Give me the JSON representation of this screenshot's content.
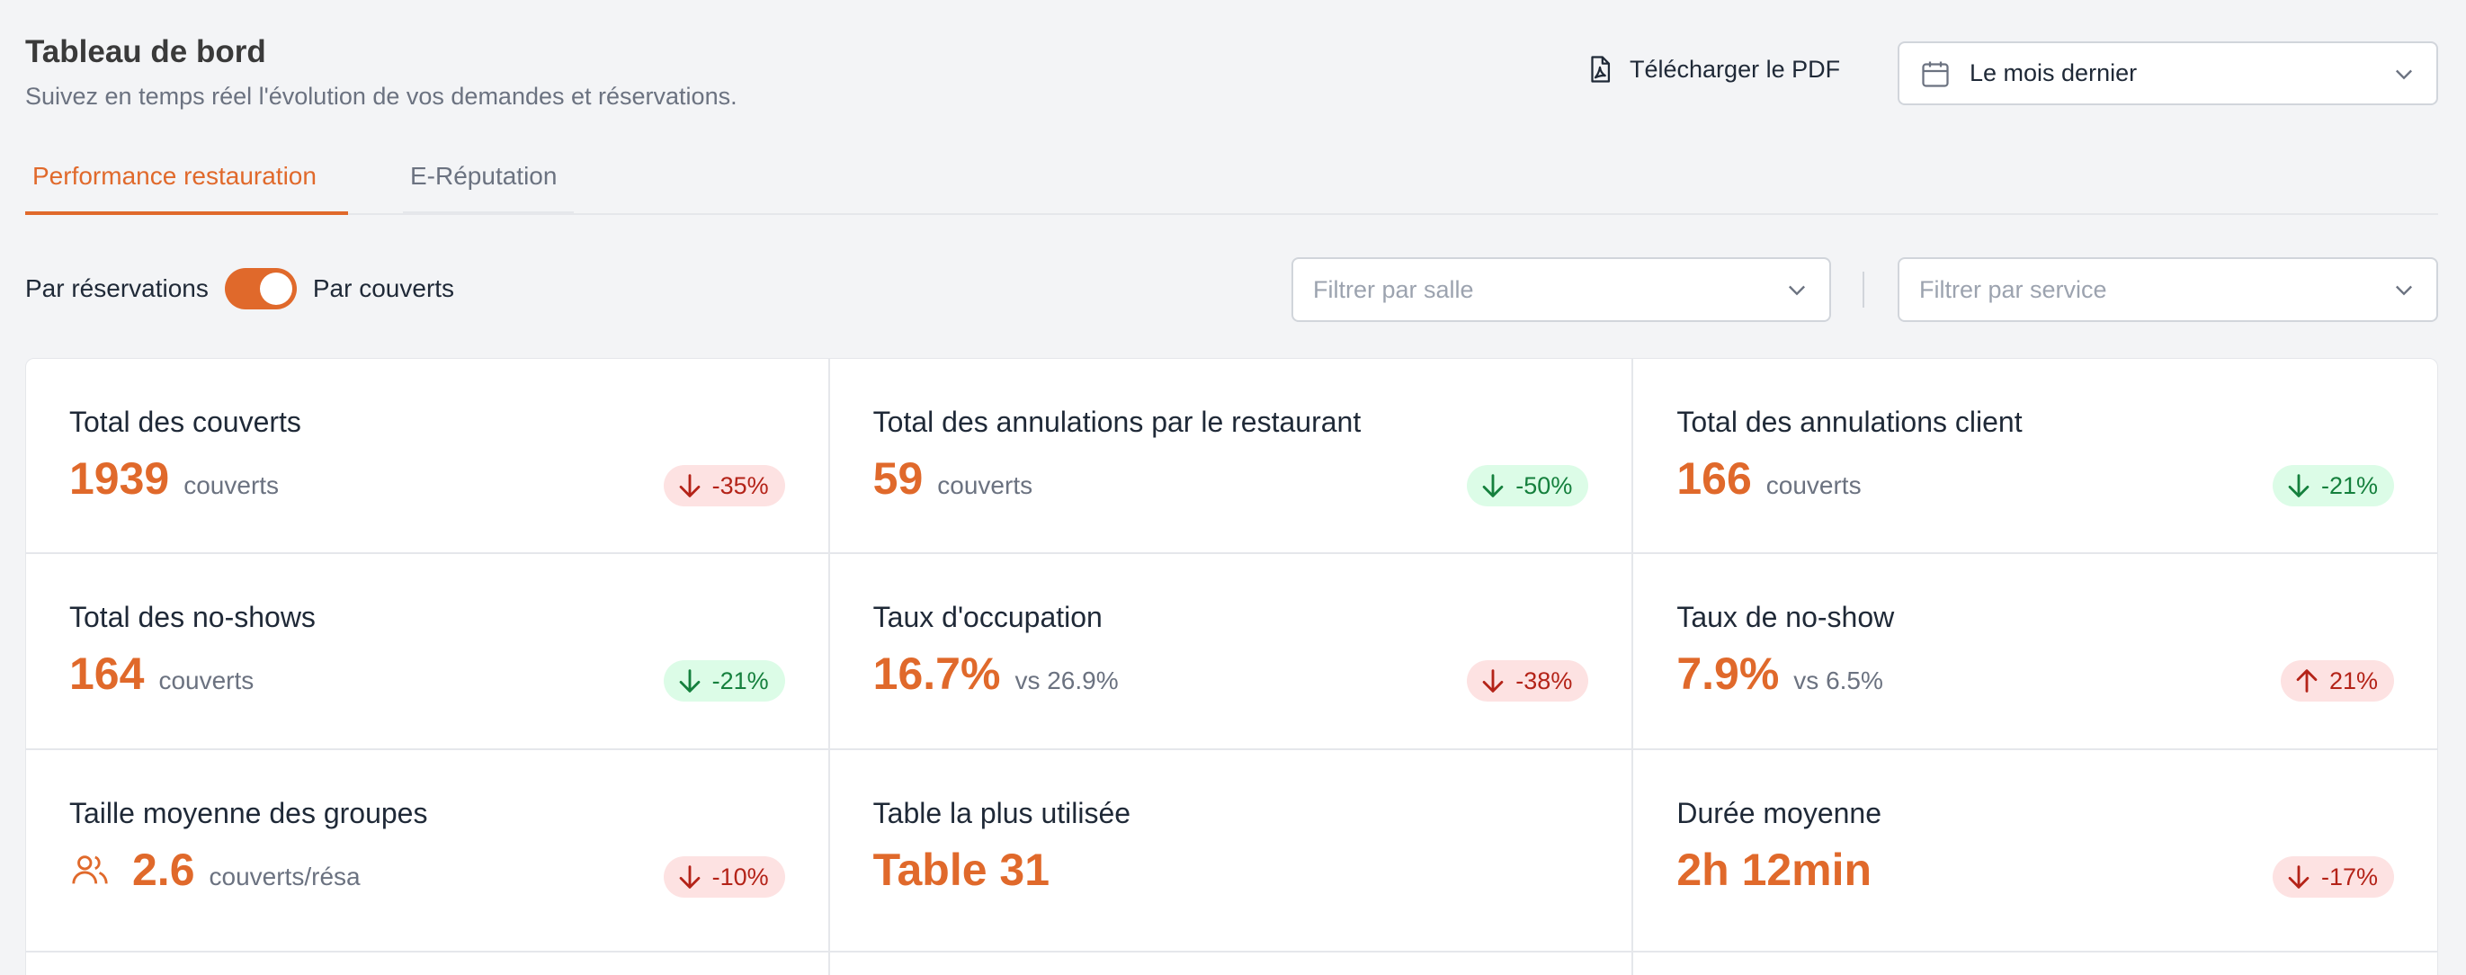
{
  "header": {
    "title": "Tableau de bord",
    "subtitle": "Suivez en temps réel l'évolution de vos demandes et réservations.",
    "pdf_label": "Télécharger le PDF",
    "period_selected": "Le mois dernier"
  },
  "tabs": [
    {
      "label": "Performance restauration",
      "active": true
    },
    {
      "label": "E-Réputation",
      "active": false
    }
  ],
  "toggle": {
    "left_label": "Par réservations",
    "right_label": "Par couverts",
    "state": "right"
  },
  "filters": {
    "salle_placeholder": "Filtrer par salle",
    "service_placeholder": "Filtrer par service"
  },
  "colors": {
    "accent": "#e0692b",
    "badge_red_bg": "#fde2e2",
    "badge_green_bg": "#dcfce7"
  },
  "cards": [
    {
      "label": "Total des couverts",
      "value": "1939",
      "unit": "couverts",
      "badge": "-35%",
      "direction": "down",
      "tone": "red"
    },
    {
      "label": "Total des annulations par le restaurant",
      "value": "59",
      "unit": "couverts",
      "badge": "-50%",
      "direction": "down",
      "tone": "green"
    },
    {
      "label": "Total des annulations client",
      "value": "166",
      "unit": "couverts",
      "badge": "-21%",
      "direction": "down",
      "tone": "green"
    },
    {
      "label": "Total des no-shows",
      "value": "164",
      "unit": "couverts",
      "badge": "-21%",
      "direction": "down",
      "tone": "green"
    },
    {
      "label": "Taux d'occupation",
      "value": "16.7%",
      "unit": "vs 26.9%",
      "badge": "-38%",
      "direction": "down",
      "tone": "red"
    },
    {
      "label": "Taux de no-show",
      "value": "7.9%",
      "unit": "vs 6.5%",
      "badge": "21%",
      "direction": "up",
      "tone": "red"
    },
    {
      "label": "Taille moyenne des groupes",
      "value": "2.6",
      "unit": "couverts/résa",
      "badge": "-10%",
      "direction": "down",
      "tone": "red",
      "icon": "group-icon"
    },
    {
      "label": "Table la plus utilisée",
      "value": "Table 31",
      "unit": "",
      "badge": "",
      "direction": "",
      "tone": ""
    },
    {
      "label": "Durée moyenne",
      "value": "2h 12min",
      "unit": "",
      "badge": "-17%",
      "direction": "down",
      "tone": "red"
    }
  ]
}
